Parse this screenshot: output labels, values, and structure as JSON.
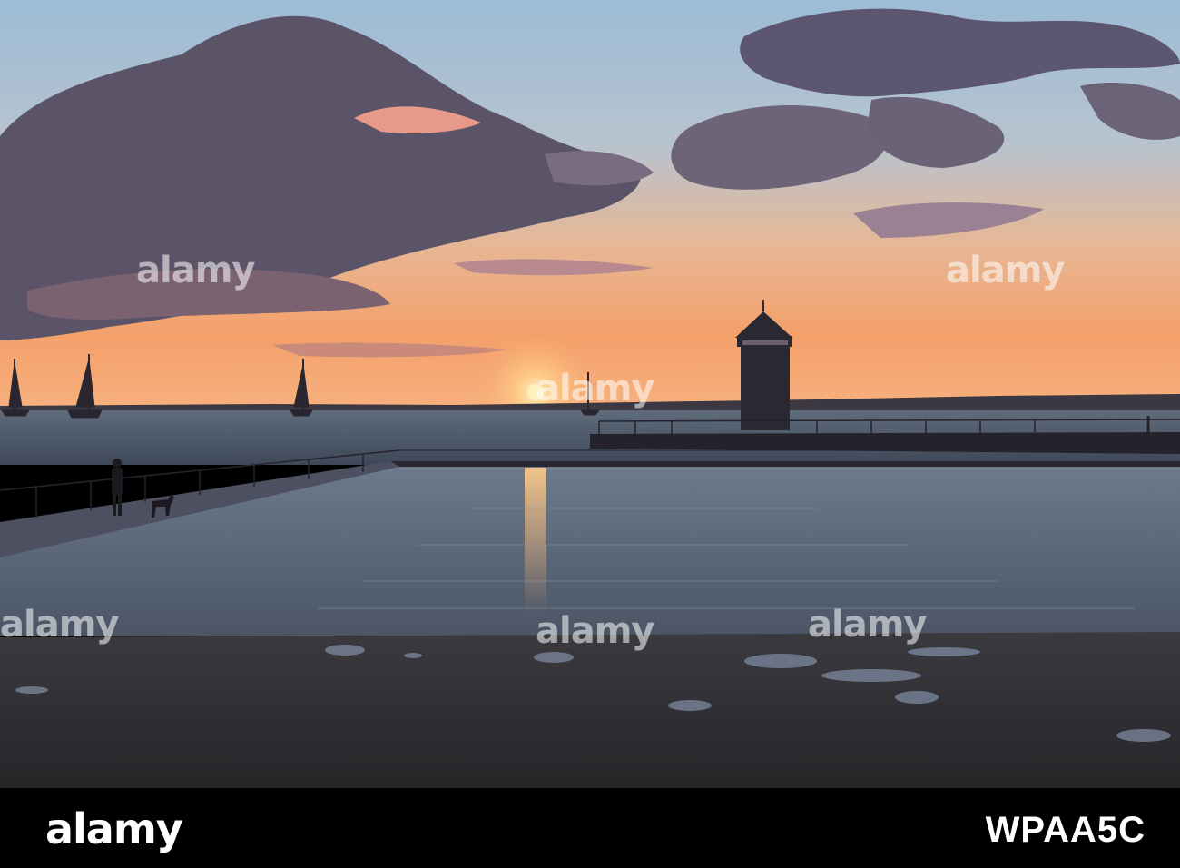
{
  "watermark": "alamy",
  "footer": {
    "logo": "alamy",
    "image_id": "WPAA5C"
  },
  "colors": {
    "sky_top": "#8fb3d4",
    "horizon": "#f6a66e",
    "sun": "#ffe2a0",
    "water": "#3f4d5e",
    "mud": "#2e2e33"
  }
}
